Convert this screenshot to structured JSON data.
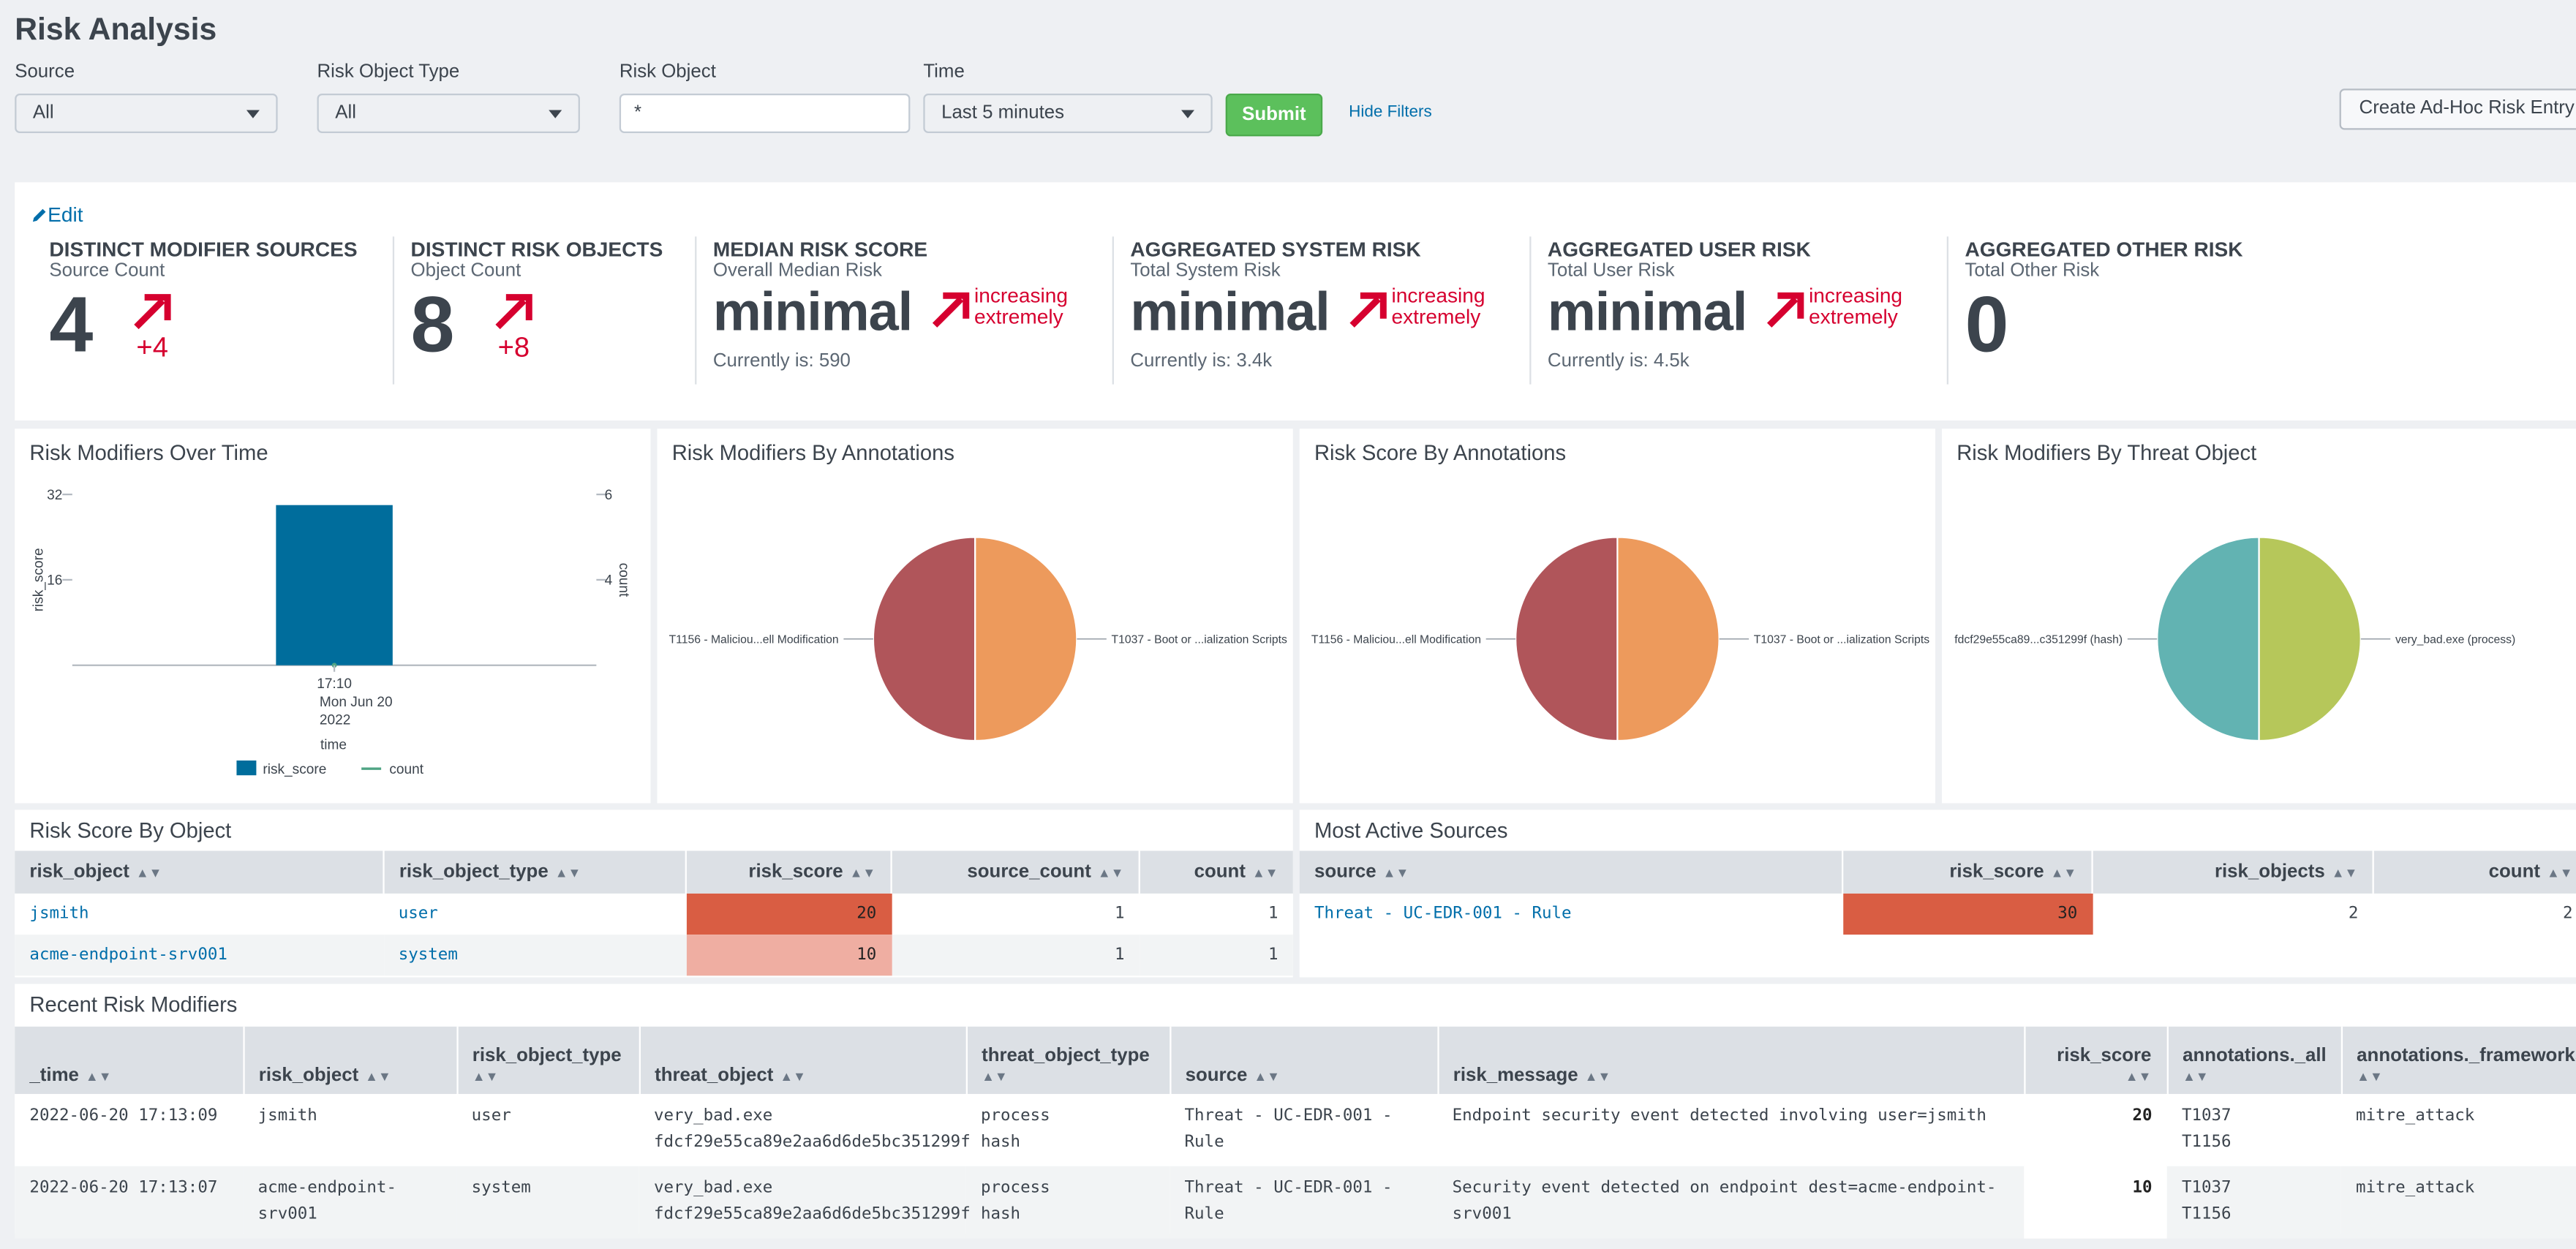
{
  "page": {
    "title": "Risk Analysis"
  },
  "filters": {
    "source": {
      "label": "Source",
      "value": "All"
    },
    "risk_object_type": {
      "label": "Risk Object Type",
      "value": "All"
    },
    "risk_object": {
      "label": "Risk Object",
      "value": "*"
    },
    "time": {
      "label": "Time",
      "value": "Last 5 minutes"
    },
    "submit": "Submit",
    "hide_filters": "Hide Filters",
    "create_adhoc": "Create Ad-Hoc Risk Entry"
  },
  "edit_label": "Edit",
  "kpis": [
    {
      "title": "DISTINCT MODIFIER SOURCES",
      "subtitle": "Source Count",
      "value": "4",
      "delta": "+4"
    },
    {
      "title": "DISTINCT RISK OBJECTS",
      "subtitle": "Object Count",
      "value": "8",
      "delta": "+8"
    },
    {
      "title": "MEDIAN RISK SCORE",
      "subtitle": "Overall Median Risk",
      "value": "minimal",
      "trend_line1": "increasing",
      "trend_line2": "extremely",
      "current": "Currently is: 590"
    },
    {
      "title": "AGGREGATED SYSTEM RISK",
      "subtitle": "Total System Risk",
      "value": "minimal",
      "trend_line1": "increasing",
      "trend_line2": "extremely",
      "current": "Currently is: 3.4k"
    },
    {
      "title": "AGGREGATED USER RISK",
      "subtitle": "Total User Risk",
      "value": "minimal",
      "trend_line1": "increasing",
      "trend_line2": "extremely",
      "current": "Currently is: 4.5k"
    },
    {
      "title": "AGGREGATED OTHER RISK",
      "subtitle": "Total Other Risk",
      "value": "0"
    }
  ],
  "panels": {
    "modifiers_over_time": "Risk Modifiers Over Time",
    "modifiers_by_annotations": "Risk Modifiers By Annotations",
    "score_by_annotations": "Risk Score By Annotations",
    "modifiers_by_threat": "Risk Modifiers By Threat Object",
    "score_by_object": "Risk Score By Object",
    "most_active_sources": "Most Active Sources",
    "recent_modifiers": "Recent Risk Modifiers"
  },
  "chart_data": [
    {
      "type": "bar",
      "categories": [
        "17:10 Mon Jun 20 2022"
      ],
      "cat_lines": [
        "17:10",
        "Mon Jun 20",
        "2022"
      ],
      "series": [
        {
          "name": "risk_score",
          "values": [
            30
          ],
          "color": "#006d9c"
        },
        {
          "name": "count",
          "values": [
            2
          ],
          "color": "#4fa484"
        }
      ],
      "xlabel": "time",
      "ylabel": "risk_score",
      "y2label": "count",
      "yticks": [
        16,
        32
      ],
      "y2ticks": [
        4,
        6
      ],
      "ylim": [
        0,
        32
      ],
      "y2lim": [
        2,
        6
      ]
    },
    {
      "type": "pie",
      "labels": [
        "T1156 - Maliciou...ell Modification",
        "T1037 - Boot or ...ialization Scripts"
      ],
      "values": [
        1,
        1
      ],
      "colors": [
        "#b0555a",
        "#ed9a5c"
      ]
    },
    {
      "type": "pie",
      "labels": [
        "T1156 - Maliciou...ell Modification",
        "T1037 - Boot or ...ialization Scripts"
      ],
      "values": [
        1,
        1
      ],
      "colors": [
        "#b0555a",
        "#ed9a5c"
      ]
    },
    {
      "type": "pie",
      "labels": [
        "fdcf29e55ca89...c351299f (hash)",
        "very_bad.exe (process)"
      ],
      "values": [
        1,
        1
      ],
      "colors": [
        "#62b3b2",
        "#b6c75a"
      ]
    }
  ],
  "score_by_object": {
    "columns": [
      "risk_object",
      "risk_object_type",
      "risk_score",
      "source_count",
      "count"
    ],
    "rows": [
      [
        "jsmith",
        "user",
        "20",
        "1",
        "1"
      ],
      [
        "acme-endpoint-srv001",
        "system",
        "10",
        "1",
        "1"
      ]
    ],
    "heat_colors": [
      "#d95d43",
      "#efaea2"
    ]
  },
  "most_active": {
    "columns": [
      "source",
      "risk_score",
      "risk_objects",
      "count"
    ],
    "rows": [
      [
        "Threat - UC-EDR-001 - Rule",
        "30",
        "2",
        "2"
      ]
    ],
    "heat_color": "#d95d43"
  },
  "recent": {
    "columns": [
      "_time",
      "risk_object",
      "risk_object_type",
      "threat_object",
      "threat_object_type",
      "source",
      "risk_message",
      "risk_score",
      "annotations._all",
      "annotations._frameworks"
    ],
    "rows": [
      {
        "time": "2022-06-20 17:13:09",
        "risk_object": [
          "jsmith"
        ],
        "risk_object_type": "user",
        "threat_object": [
          "very_bad.exe",
          "fdcf29e55ca89e2aa6d6de5bc351299f"
        ],
        "threat_object_type": [
          "process",
          "hash"
        ],
        "source": [
          "Threat - UC-EDR-001 -",
          "Rule"
        ],
        "risk_message": [
          "Endpoint security event detected involving user=jsmith"
        ],
        "risk_score": "20",
        "annotations_all": [
          "T1037",
          "T1156"
        ],
        "frameworks": "mitre_attack"
      },
      {
        "time": "2022-06-20 17:13:07",
        "risk_object": [
          "acme-endpoint-",
          "srv001"
        ],
        "risk_object_type": "system",
        "threat_object": [
          "very_bad.exe",
          "fdcf29e55ca89e2aa6d6de5bc351299f"
        ],
        "threat_object_type": [
          "process",
          "hash"
        ],
        "source": [
          "Threat - UC-EDR-001 -",
          "Rule"
        ],
        "risk_message": [
          "Security event detected on endpoint dest=acme-endpoint-",
          "srv001"
        ],
        "risk_score": "10",
        "annotations_all": [
          "T1037",
          "T1156"
        ],
        "frameworks": "mitre_attack"
      }
    ]
  }
}
